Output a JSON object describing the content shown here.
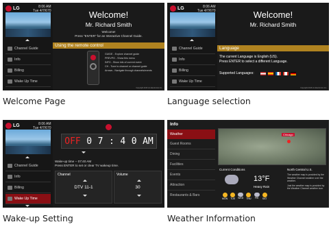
{
  "captions": [
    "Welcome Page",
    "Language selection",
    "Wake-up Setting",
    "Weather Information"
  ],
  "brand": "LG",
  "clock": {
    "time": "8:06 AM",
    "date": "Tue 4/7/670"
  },
  "menu": [
    "Channel Guide",
    "Info",
    "Billing",
    "Wake Up Time"
  ],
  "welcome": {
    "title": "Welcome!",
    "guest": "Mr. Richard Smith",
    "line1": "Welcome!",
    "line2": "Press \"ENTER\" for an Interactive Channel Guide.",
    "section": "Using the remote control",
    "remote_lines": [
      "GUIDE - Explore channel guide",
      "PREVPG - Show this menu",
      "INFO - Show info of current event",
      "CH - Tune to channel or channel guide",
      "Arrows - Navigate through channels/events"
    ]
  },
  "language": {
    "title": "Welcome!",
    "guest": "Mr. Richard Smith",
    "section": "Language",
    "line1": "The current Language is English (US).",
    "line2": "Press ENTER to select a different Language.",
    "supported": "Supported Languages:"
  },
  "wakeup": {
    "off": "OFF",
    "digits": [
      "0",
      "7",
      ":",
      "4",
      "0"
    ],
    "ampm": "AM",
    "line1": "Wake-up time -- 07:40 AM",
    "line2": "Press ENTER to set or clear TV wakeup time.",
    "channel_label": "Channel",
    "channel_value": "DTV 11-1",
    "volume_label": "Volume",
    "volume_value": "30"
  },
  "weather": {
    "header": "Info",
    "menu": [
      "Weather",
      "Guest Rooms",
      "Dining",
      "Facilities",
      "Events",
      "Attraction",
      "Restaurants & Bars"
    ],
    "conditions_label": "Current Conditions",
    "temp": "13°F",
    "desc": "Heavy Rain",
    "region": "North Central U.S.",
    "city": "Chicago",
    "note1": "The weather map is provided by the Weather Channel weather over the weather.",
    "note2": "Just the weather map is provided by the Weather Channel weather icon.",
    "forecast_days": [
      "MON",
      "TUE",
      "WED",
      "THU",
      "FRI",
      "SAT"
    ]
  },
  "copyright": "Copyright 2016 LG Electronics Inc."
}
